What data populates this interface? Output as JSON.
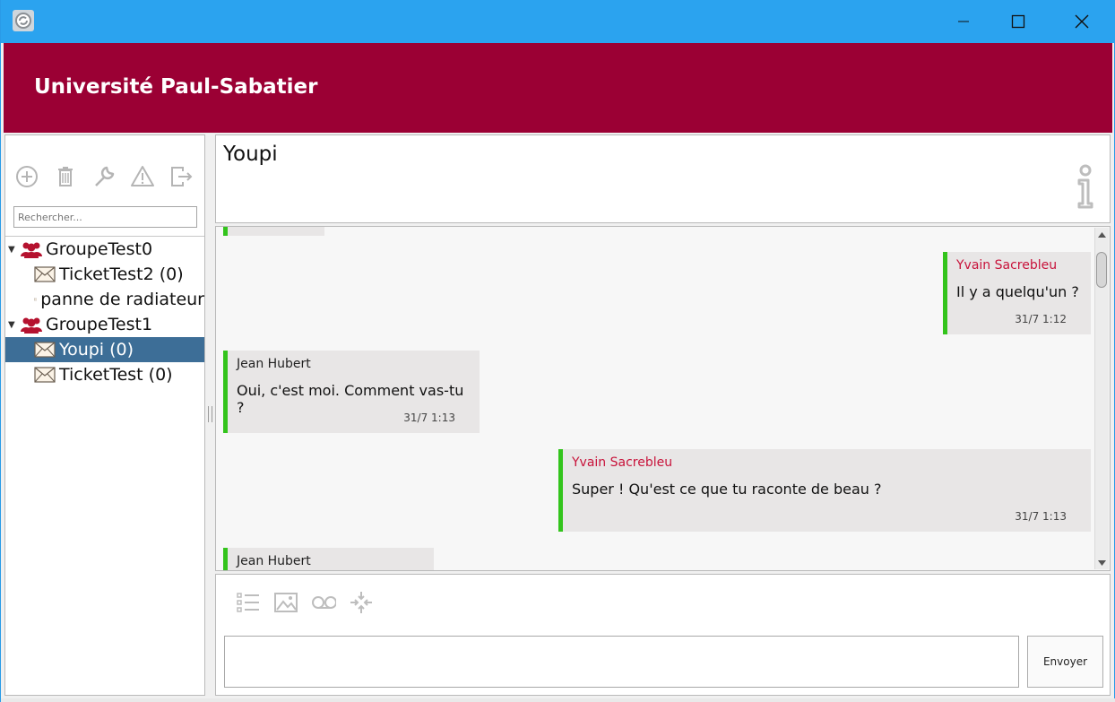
{
  "window": {
    "app_icon": "app-logo-icon",
    "controls": {
      "minimize": "minimize-icon",
      "maximize": "maximize-icon",
      "close": "close-icon"
    }
  },
  "header": {
    "title": "Université Paul-Sabatier",
    "background": "#9b0034"
  },
  "sidebar": {
    "toolbar": [
      {
        "icon": "add-circle-icon"
      },
      {
        "icon": "trash-icon"
      },
      {
        "icon": "wrench-icon"
      },
      {
        "icon": "warning-icon"
      },
      {
        "icon": "exit-icon"
      }
    ],
    "search_placeholder": "Rechercher...",
    "tree": [
      {
        "type": "group",
        "label": "GroupeTest0",
        "expanded": true
      },
      {
        "type": "ticket",
        "label": "TicketTest2 (0)"
      },
      {
        "type": "ticket",
        "label": "panne de radiateur"
      },
      {
        "type": "group",
        "label": "GroupeTest1",
        "expanded": true
      },
      {
        "type": "ticket",
        "label": "Youpi (0)",
        "selected": true
      },
      {
        "type": "ticket",
        "label": "TicketTest (0)"
      }
    ]
  },
  "conversation": {
    "title": "Youpi",
    "info_icon": "info-icon",
    "messages": [
      {
        "author": "Yvain Sacrebleu",
        "text": "Il y a quelqu'un ?",
        "time": "31/7 1:12",
        "mine": true
      },
      {
        "author": "Jean Hubert",
        "text": "Oui, c'est moi. Comment vas-tu ?",
        "time": "31/7 1:13",
        "mine": false
      },
      {
        "author": "Yvain Sacrebleu",
        "text": "Super ! Qu'est ce que tu raconte de beau ?",
        "time": "31/7 1:13",
        "mine": true
      },
      {
        "author": "Jean Hubert",
        "text": "",
        "time": "",
        "mine": false
      }
    ],
    "accent_color": "#33c41c",
    "own_author_color": "#c8123a"
  },
  "composer": {
    "tools": [
      {
        "icon": "list-icon"
      },
      {
        "icon": "image-icon"
      },
      {
        "icon": "voicemail-icon"
      },
      {
        "icon": "collapse-icon"
      }
    ],
    "input_value": "",
    "send_label": "Envoyer"
  }
}
